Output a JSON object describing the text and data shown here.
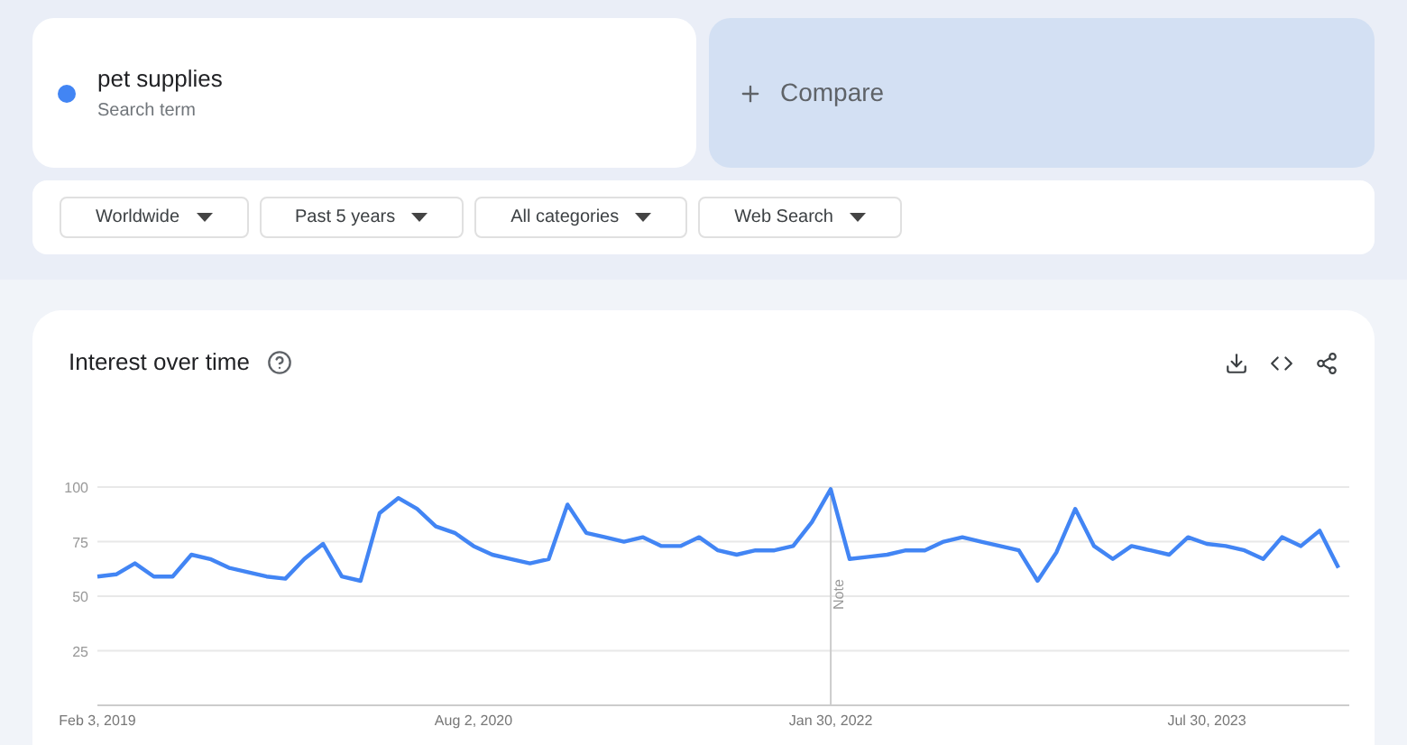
{
  "search_term": {
    "color": "#4285f4",
    "term": "pet supplies",
    "caption": "Search term"
  },
  "compare": {
    "label": "Compare"
  },
  "filters": [
    "Worldwide",
    "Past 5 years",
    "All categories",
    "Web Search"
  ],
  "interest_over_time": {
    "title": "Interest over time",
    "chart_data": {
      "type": "line",
      "grid": true,
      "ylim": [
        0,
        100
      ],
      "yticks": [
        25,
        50,
        75,
        100
      ],
      "categories": [
        "Feb 3, 2019",
        null,
        null,
        null,
        null,
        null,
        null,
        null,
        null,
        null,
        null,
        null,
        null,
        null,
        null,
        null,
        null,
        null,
        null,
        null,
        "Aug 2, 2020",
        null,
        null,
        null,
        null,
        null,
        null,
        null,
        null,
        null,
        null,
        null,
        null,
        null,
        null,
        null,
        null,
        null,
        null,
        "Jan 30, 2022",
        null,
        null,
        null,
        null,
        null,
        null,
        null,
        null,
        null,
        null,
        null,
        null,
        null,
        null,
        null,
        null,
        null,
        null,
        null,
        "Jul 30, 2023",
        null,
        null,
        null,
        null,
        null,
        null,
        null
      ],
      "series": [
        {
          "color": "#4285f4",
          "values": [
            59,
            60,
            65,
            59,
            59,
            69,
            67,
            63,
            61,
            59,
            58,
            67,
            74,
            59,
            57,
            88,
            95,
            90,
            82,
            79,
            73,
            69,
            67,
            65,
            67,
            92,
            79,
            77,
            75,
            77,
            73,
            73,
            77,
            71,
            69,
            71,
            71,
            73,
            84,
            99,
            67,
            68,
            69,
            71,
            71,
            75,
            77,
            75,
            73,
            71,
            57,
            70,
            90,
            73,
            67,
            73,
            71,
            69,
            77,
            74,
            73,
            71,
            67,
            77,
            73,
            80,
            63
          ]
        }
      ],
      "annotations": [
        "Note"
      ]
    }
  }
}
